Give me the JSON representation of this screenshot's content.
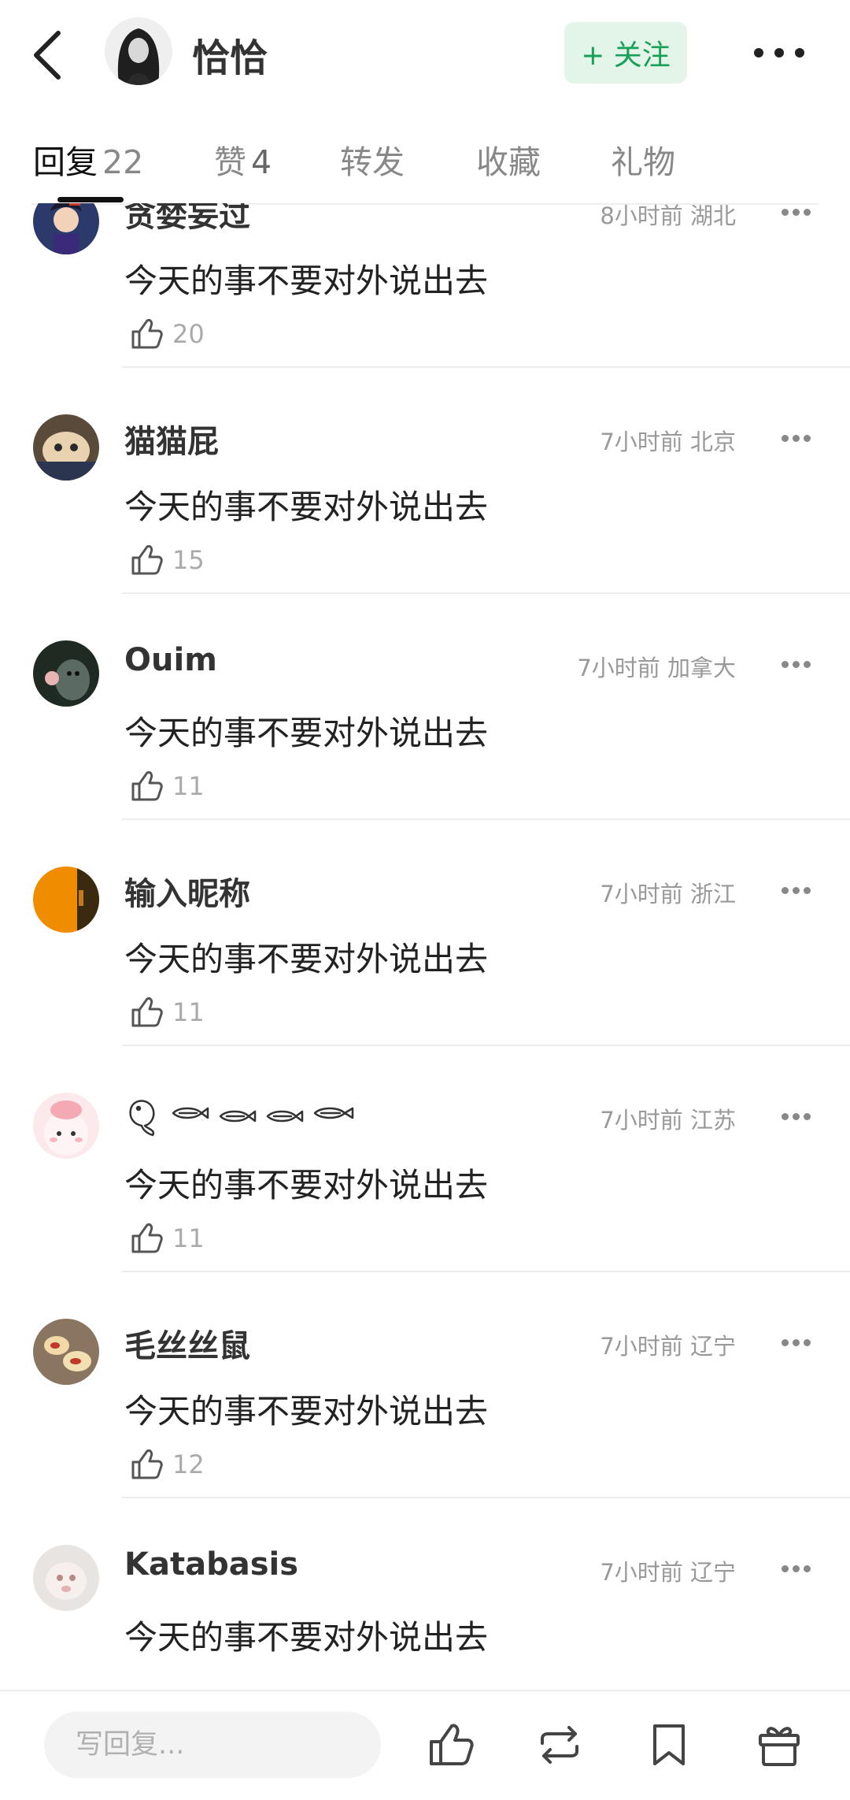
{
  "header": {
    "user_name": "恰恰",
    "follow_label": "+ 关注"
  },
  "tabs": [
    {
      "label": "回复",
      "count": "22",
      "active": true
    },
    {
      "label": "赞",
      "count": "4",
      "active": false
    },
    {
      "label": "转发",
      "count": "",
      "active": false
    },
    {
      "label": "收藏",
      "count": "",
      "active": false
    },
    {
      "label": "礼物",
      "count": "",
      "active": false
    }
  ],
  "comments": [
    {
      "name": "贪婪妄过",
      "meta": "8小时前 湖北",
      "text": "今天的事不要对外说出去",
      "likes": "20"
    },
    {
      "name": "猫猫屁",
      "meta": "7小时前 北京",
      "text": "今天的事不要对外说出去",
      "likes": "15"
    },
    {
      "name": "Ouim",
      "meta": "7小时前 加拿大",
      "text": "今天的事不要对外说出去",
      "likes": "11"
    },
    {
      "name": "输入昵称",
      "meta": "7小时前 浙江",
      "text": "今天的事不要对外说出去",
      "likes": "11"
    },
    {
      "name": "",
      "meta": "7小时前 江苏",
      "text": "今天的事不要对外说出去",
      "likes": "11"
    },
    {
      "name": "毛丝丝鼠",
      "meta": "7小时前 辽宁",
      "text": "今天的事不要对外说出去",
      "likes": "12"
    },
    {
      "name": "Katabasis",
      "meta": "7小时前 辽宁",
      "text": "今天的事不要对外说出去",
      "likes": ""
    }
  ],
  "bottom_bar": {
    "reply_placeholder": "写回复..."
  },
  "colors": {
    "accent_green": "#18a058",
    "follow_bg": "#e3f5e9"
  },
  "icons": {
    "back": "chevron-left-icon",
    "more": "more-horizontal-icon",
    "like": "thumbs-up-icon",
    "repost": "repost-icon",
    "bookmark": "bookmark-icon",
    "gift": "gift-icon"
  }
}
